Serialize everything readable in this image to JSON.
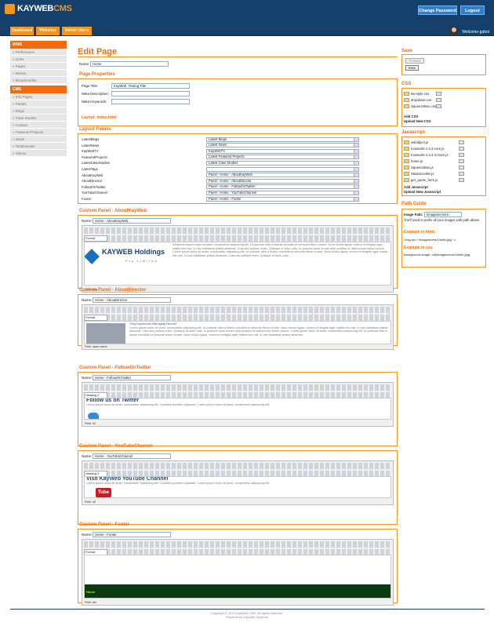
{
  "header": {
    "logo": "KAYWEB",
    "logo_suffix": "CMS",
    "change_password": "Change Password",
    "logout": "Logout",
    "welcome": "Welcome gabot"
  },
  "nav": [
    "Dashboard",
    "Websites",
    "Admin Users"
  ],
  "sidebar": {
    "wms_title": "WMS",
    "wms": [
      "» Preferences",
      "» Links",
      "» Pages",
      "» Menus",
      "» Breadcrumbs"
    ],
    "cms_title": "CMS",
    "cms": [
      "» Info Pages",
      "» Panels",
      "» Blogs",
      "» Case Studies",
      "» Contact",
      "» Featured Projects",
      "» News",
      "» Testimonials",
      "» Videos"
    ]
  },
  "page": {
    "title": "Edit Page",
    "name_label": "Name:",
    "name_value": "Home"
  },
  "properties": {
    "title": "Page Properties",
    "page_title_label": "Page Title:",
    "page_title_value": "KayWeb: Testing Title",
    "meta_desc_label": "Meta Description:",
    "meta_kw_label": "Meta Keywords:",
    "layout_label": "Layout:",
    "layout_value": "index.html"
  },
  "layout_panels": {
    "title": "Layout Panels",
    "rows": [
      [
        "LatestBlogs",
        "Latest Blogs"
      ],
      [
        "LatestNews",
        "Latest News"
      ],
      [
        "KayWebTV",
        "KayWebTV"
      ],
      [
        "FeaturedProjects",
        "Latest Featured Projects"
      ],
      [
        "LatestCaseStudies",
        "Latest Case Studies"
      ],
      [
        "LatestTags",
        ""
      ],
      [
        "AboutKayWeb",
        "Panel - Home - AboutKayWeb"
      ],
      [
        "AboutDirector",
        "Panel - Home - AboutDirector"
      ],
      [
        "FollowOnTwitter",
        "Panel - Home - FollowOnTwitter"
      ],
      [
        "YouTubeChannel",
        "Panel - Home - YouTubeChannel"
      ],
      [
        "Footer",
        "Panel - Home - Footer"
      ]
    ]
  },
  "panels": [
    {
      "title": "Custom Panel - AboutKayWeb",
      "name": "Home - AboutKayWeb",
      "heading": "",
      "body": "Whatever ipsum dolor sit amet, consectetur adipiscing elit. Ut pulvinar nibh a lectus convallis et vehicula libero ornare. Nunc lectus ligula, viverra id fringilla eget, mattis nec nisl. In hac habitasse platea dictumst. Cras sed pretium enim. Quisque ut dolor odio. In posuere risus ornare sem porttitor ut ullamcorper tellus cursus. Lorem ipsum dolor sit amet, consectetur adipiscing elit. Ut pulvinar nibh a lectus convallis et vehicula libero ornare. Nunc lectus ligula, viverra id fringilla eget, mattis nec nisl. In hac habitasse platea dictumst. Cras sed pretium enim. Quisque ut dolor odio.",
      "path": "Path: img",
      "format": "Format",
      "brand": "KAYWEB Holdings",
      "brand_sub": "Pty Limited"
    },
    {
      "title": "Custom Panel - AboutDirector",
      "name": "Home - AboutDirector",
      "heading": "Greg Kamerman Managing Director",
      "body": "Lorem ipsum dolor sit amet, consectetur adipiscing elit. Ut pulvinar nibh a lectus convallis et vehicula libero ornare. Nunc lectus ligula, viverra id fringilla eget, mattis nec nisl. In hac habitasse platea dictumst. Cras sed pretium enim. Quisque ut dolor odio. In posuere risus ornare sem porttitor ut ullamcorper tellus cursus. Lorem ipsum dolor sit amet, consectetur adipiscing elit. Ut pulvinar nibh a lectus convallis et vehicula libero ornare. Nunc lectus ligula, viverra id fringilla eget, mattis nec nisl. In hac habitasse platea dictumst.",
      "path": "Path: span.name",
      "format": "Format"
    },
    {
      "title": "Custom Panel - FollowOnTwitter",
      "name": "Home - FollowOnTwitter",
      "heading": "Follow us on Twitter",
      "body": "Lorem ipsum dolor sit amet, consectetur adipiscing elit. Curabitur porttitor vulputate. Lorem ipsum dolor sit amet, consectetur adipiscing elit.",
      "path": "Path: h2",
      "format": "Heading 2"
    },
    {
      "title": "Custom Panel - YouTubeChannel",
      "name": "Home - YouTubeChannel",
      "heading": "Visit KayWeb YouTube Channel",
      "body": "Lorem ipsum dolor sit amet, consectetur adipiscing elit. Curabitur porttitor vulputate. Lorem ipsum dolor sit amet, consectetur adipiscing elit.",
      "path": "Path: h2",
      "format": "Heading 2",
      "yt": "Tube"
    },
    {
      "title": "Custom Panel - Footer",
      "name": "Home - Footer",
      "heading": "Home",
      "body": "",
      "path": "Path: div",
      "format": "Format"
    }
  ],
  "save": {
    "title": "Save",
    "preview": "Preview",
    "save": "Save"
  },
  "css": {
    "title": "CSS",
    "files": [
      "kw-style.css",
      "dropdown.css",
      "SqueezeBox.css"
    ],
    "add": "Add CSS",
    "upload": "Upload New CSS"
  },
  "js": {
    "title": "Javascript",
    "files": [
      "swfobject.js",
      "mootools-1.2.4-core.js",
      "mootools-1.2.4.4-more.js",
      "home.js",
      "SqueezeBox.js",
      "StaticScroller.js",
      "get_quote_form.js"
    ],
    "add": "Add Javascript",
    "upload": "Upload New Javascript"
  },
  "path_guide": {
    "title": "Path Guide",
    "image_path_label": "Image Path:",
    "image_path": "/images/cms/1/",
    "note": "You'll need to prefix all your images with path above.",
    "html_label": "Example in html:",
    "html_code": "<img src=\"/images/cms/1/hello.jpg\" />",
    "css_label": "Example in css:",
    "css_code": "background-image: url(/images/cms/1/hello.jpg);"
  },
  "footer": {
    "copyright": "Copyright © 2013 KayWeb CMS. All rights reserved.",
    "powered": "Powered by KayWeb Systems"
  }
}
